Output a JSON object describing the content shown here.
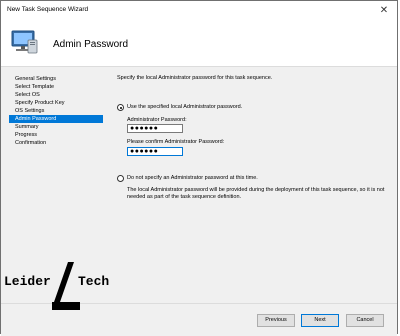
{
  "window": {
    "title": "New Task Sequence Wizard"
  },
  "header": {
    "title": "Admin Password"
  },
  "nav": {
    "items": [
      {
        "label": "General Settings"
      },
      {
        "label": "Select Template"
      },
      {
        "label": "Select OS"
      },
      {
        "label": "Specify Product Key"
      },
      {
        "label": "OS Settings"
      },
      {
        "label": "Admin Password"
      },
      {
        "label": "Summary"
      },
      {
        "label": "Progress"
      },
      {
        "label": "Confirmation"
      }
    ],
    "selected": "Admin Password"
  },
  "main": {
    "instruction": "Specify the local Administrator password for this task sequence.",
    "option_specify": {
      "label": "Use the specified local Administrator password.",
      "selected": true
    },
    "admin_password": {
      "label": "Administrator Password:",
      "value": "●●●●●●"
    },
    "confirm_password": {
      "label": "Please confirm Administrator Password:",
      "value": "●●●●●●"
    },
    "option_none": {
      "label": "Do not specify an Administrator password at this time.",
      "selected": false
    },
    "note": "The local Administrator password will be provided during the deployment of this task sequence, so it is not needed as part of the task sequence definition."
  },
  "footer": {
    "previous_label": "Previous",
    "next_label": "Next",
    "cancel_label": "Cancel"
  },
  "watermark": {
    "left_word": "Leider",
    "right_word": "Tech"
  },
  "colors": {
    "selection": "#0078d7",
    "panel": "#f0f0f0"
  },
  "icons": {
    "header": "computer-icon",
    "close": "close-icon"
  }
}
